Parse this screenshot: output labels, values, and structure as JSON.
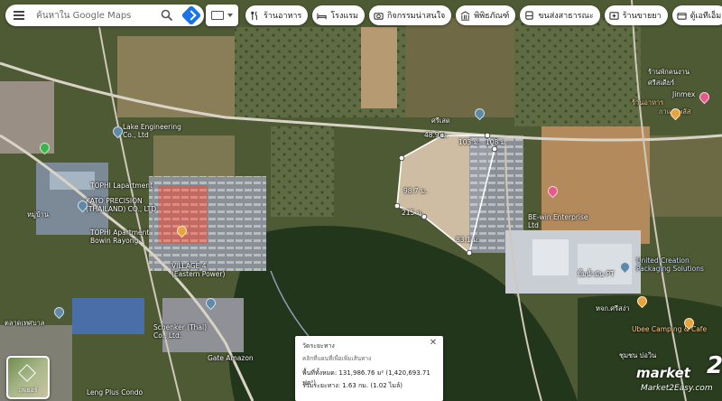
{
  "search": {
    "placeholder": "ค้นหาใน Google Maps"
  },
  "chips": [
    {
      "label": "ร้านอาหาร",
      "icon": "fork-knife-icon"
    },
    {
      "label": "โรงแรม",
      "icon": "bed-icon"
    },
    {
      "label": "กิจกรรมน่าสนใจ",
      "icon": "camera-icon"
    },
    {
      "label": "พิพิธภัณฑ์",
      "icon": "museum-icon"
    },
    {
      "label": "ขนส่งสาธารณะ",
      "icon": "bus-icon"
    },
    {
      "label": "ร้านขายยา",
      "icon": "pharmacy-icon"
    },
    {
      "label": "ตู้เอทีเอ็ม",
      "icon": "atm-icon"
    }
  ],
  "map_labels": [
    {
      "text": "Lake Engineering",
      "sub": "Co., Ltd"
    },
    {
      "text": "TOPHI Lapartment"
    },
    {
      "text": "KATO PRECISION",
      "sub": "(THAILAND) CO., LTD"
    },
    {
      "text": "TOPHI Apartment",
      "sub": "Bowin Rayong"
    },
    {
      "text": "VILLAGE 4",
      "sub": "(Eastern Power)"
    },
    {
      "text": "Schenker (Thai)",
      "sub": "Co., Ltd."
    },
    {
      "text": "Gate Amazon"
    },
    {
      "text": "BE-win Enterprise",
      "sub": "Ltd"
    },
    {
      "text": "United Creation",
      "sub": "Packaging Solutions"
    },
    {
      "text": "ศรีเสด",
      "sub": "ร้านอาหาร"
    },
    {
      "text": "Jinmex"
    },
    {
      "text": "Ubee Camping & Cafe"
    },
    {
      "text": "Leng Plus Condo"
    },
    {
      "text": "กาแฟ พลัส"
    },
    {
      "text": "ปั๊มน้ำมัน PT"
    },
    {
      "text": "หจก.ศรีสง่า"
    },
    {
      "text": "ชุมชน บ่อวิน"
    },
    {
      "text": "ตลาดเทศบาล"
    },
    {
      "text": "ร้านพักคนงาน",
      "sub": "ศรีสเดียร์"
    },
    {
      "text": "ร้านอาหาร"
    },
    {
      "text": "หมู่บ้าน"
    }
  ],
  "segments": [
    "48.9 ม.",
    "103 ม.",
    "108 ม.",
    "98.7 ม.",
    "83.1 ม.",
    "215 ม."
  ],
  "measure": {
    "title": "วัดระยะทาง",
    "hint": "คลิกที่แผนที่เพื่อเพิ่มเส้นทาง",
    "area": "พื้นที่ทั้งหมด: 131,986.76 ม² (1,420,693.71 ฟุต²)",
    "distance": "รวมระยะทาง: 1.63 กม. (1.02 ไมล์)"
  },
  "layers": {
    "label": "เลเยอร์"
  },
  "watermark": {
    "prefix": "market",
    "number": "2",
    "site": "Market2Easy.com"
  }
}
